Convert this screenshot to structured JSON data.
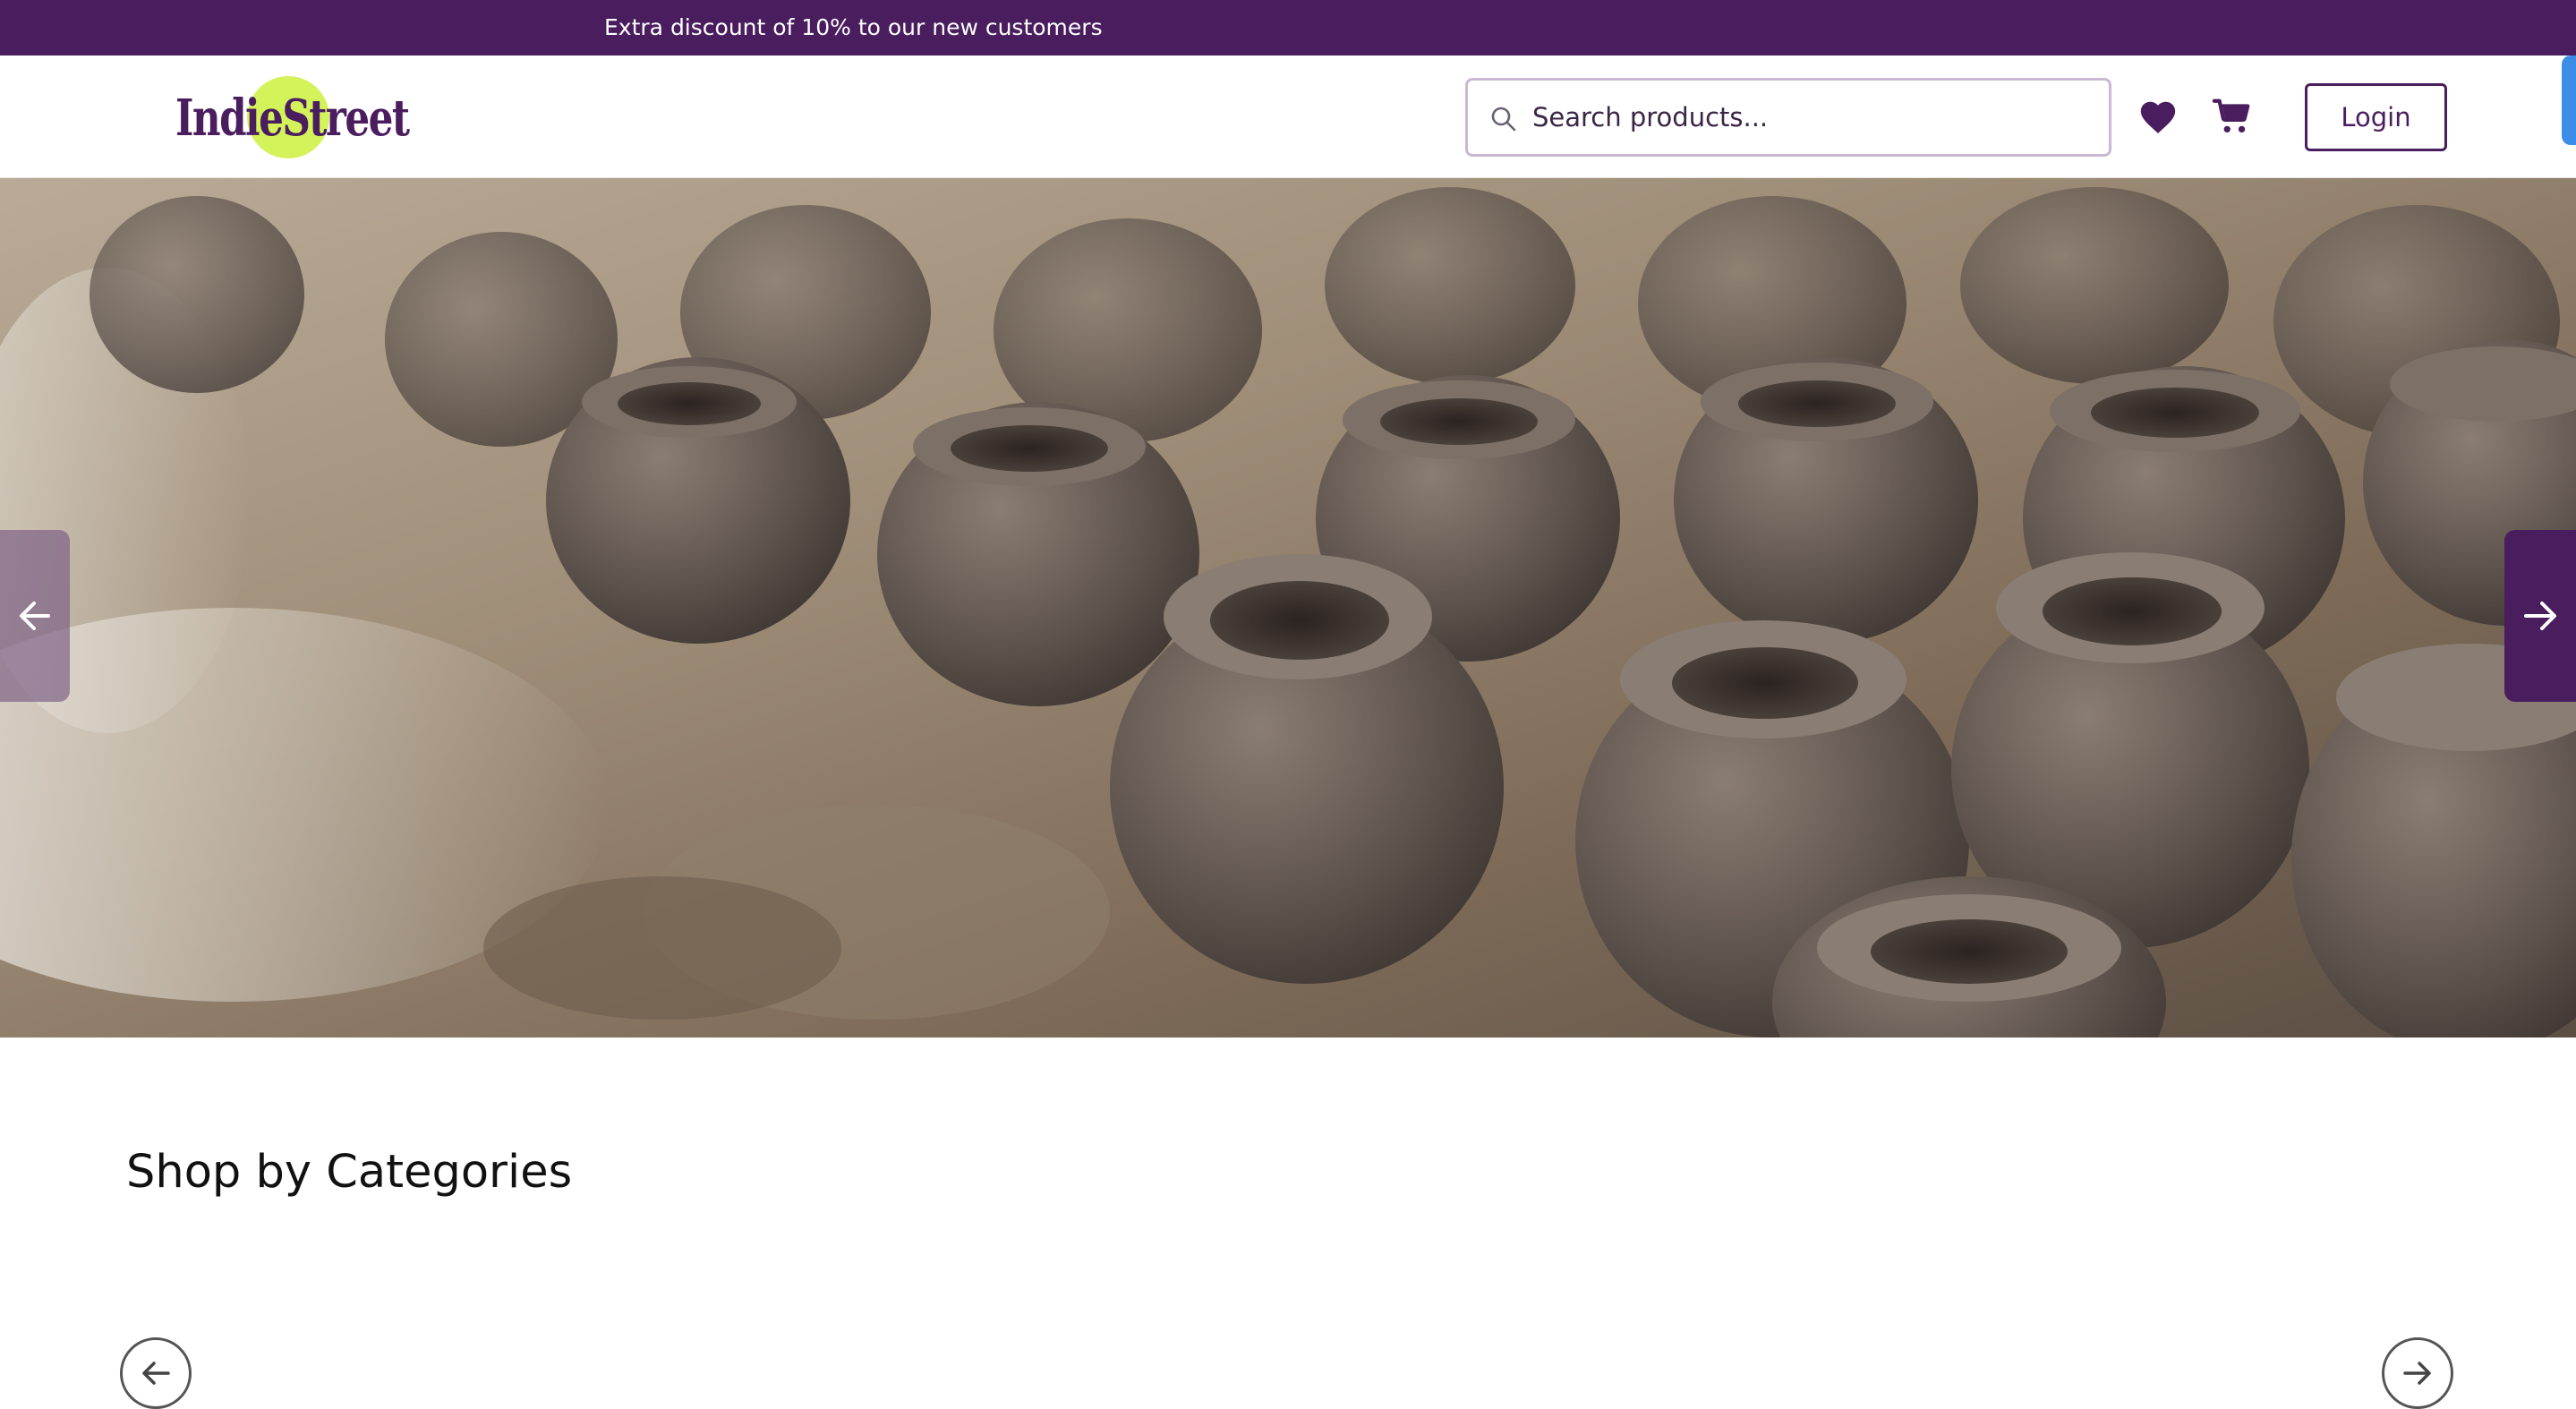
{
  "announcement": {
    "text": "Extra discount of 10% to our new customers"
  },
  "header": {
    "logo_text": "IndieStreet",
    "search_placeholder": "Search products...",
    "login_label": "Login",
    "icons": {
      "search": "search-icon",
      "wishlist": "heart-icon",
      "cart": "cart-icon"
    }
  },
  "hero": {
    "image": "clay pots drying on the ground",
    "prev_icon": "arrow-left-icon",
    "next_icon": "arrow-right-icon"
  },
  "categories": {
    "title": "Shop by Categories",
    "prev_icon": "arrow-left-icon",
    "next_icon": "arrow-right-icon"
  },
  "colors": {
    "brand": "#4a1d5f",
    "logo_accent": "#d4f25a",
    "search_border": "#c9b8d4"
  }
}
